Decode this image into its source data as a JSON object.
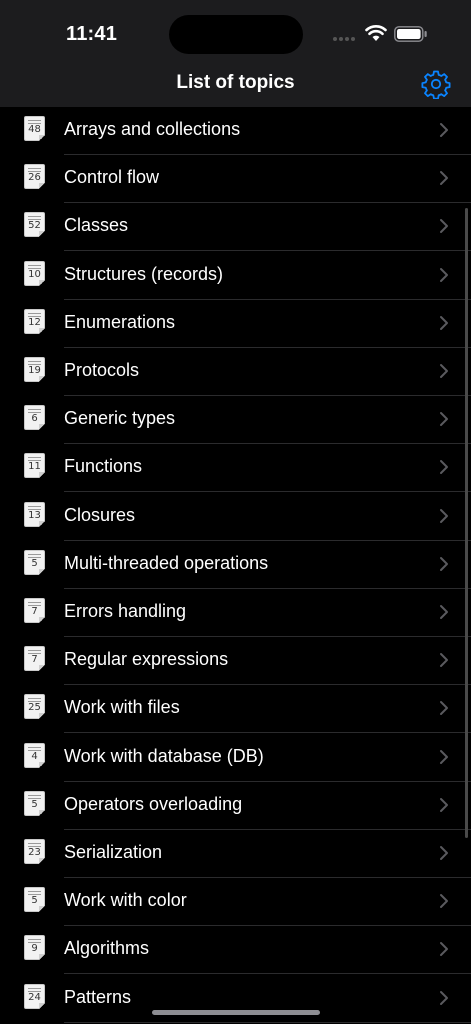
{
  "status_bar": {
    "time": "11:41"
  },
  "nav": {
    "title": "List of topics",
    "settings_icon": "gear-icon",
    "accent_color": "#0a84ff"
  },
  "topics": [
    {
      "count": "48",
      "label": "Arrays and collections"
    },
    {
      "count": "26",
      "label": "Control flow"
    },
    {
      "count": "52",
      "label": "Classes"
    },
    {
      "count": "10",
      "label": "Structures (records)"
    },
    {
      "count": "12",
      "label": "Enumerations"
    },
    {
      "count": "19",
      "label": "Protocols"
    },
    {
      "count": "6",
      "label": "Generic types"
    },
    {
      "count": "11",
      "label": "Functions"
    },
    {
      "count": "13",
      "label": "Closures"
    },
    {
      "count": "5",
      "label": "Multi-threaded operations"
    },
    {
      "count": "7",
      "label": "Errors handling"
    },
    {
      "count": "7",
      "label": "Regular expressions"
    },
    {
      "count": "25",
      "label": "Work with files"
    },
    {
      "count": "4",
      "label": "Work with database (DB)"
    },
    {
      "count": "5",
      "label": "Operators overloading"
    },
    {
      "count": "23",
      "label": "Serialization"
    },
    {
      "count": "5",
      "label": "Work with color"
    },
    {
      "count": "9",
      "label": "Algorithms"
    },
    {
      "count": "24",
      "label": "Patterns"
    }
  ]
}
